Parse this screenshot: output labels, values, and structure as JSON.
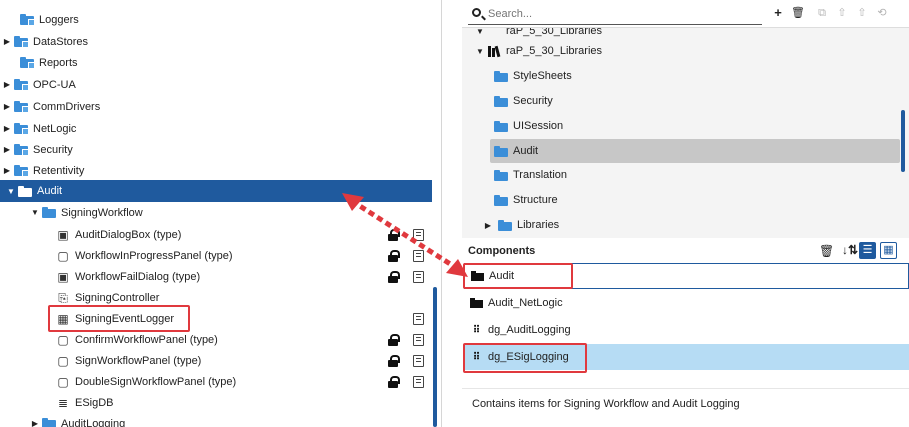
{
  "left_tree": {
    "items": [
      {
        "label": "Loggers",
        "expand": ""
      },
      {
        "label": "DataStores",
        "expand": "▶"
      },
      {
        "label": "Reports",
        "expand": ""
      },
      {
        "label": "OPC-UA",
        "expand": "▶"
      },
      {
        "label": "CommDrivers",
        "expand": "▶"
      },
      {
        "label": "NetLogic",
        "expand": "▶"
      },
      {
        "label": "Security",
        "expand": "▶"
      },
      {
        "label": "Retentivity",
        "expand": "▶"
      },
      {
        "label": "Audit",
        "expand": "▼"
      },
      {
        "label": "SigningWorkflow",
        "expand": "▼"
      },
      {
        "label": "AuditDialogBox (type)",
        "icon": "▣"
      },
      {
        "label": "WorkflowInProgressPanel (type)",
        "icon": "▢"
      },
      {
        "label": "WorkflowFailDialog (type)",
        "icon": "▣"
      },
      {
        "label": "SigningController",
        "icon": "⎘"
      },
      {
        "label": "SigningEventLogger",
        "icon": "▦"
      },
      {
        "label": "ConfirmWorkflowPanel (type)",
        "icon": "▢"
      },
      {
        "label": "SignWorkflowPanel (type)",
        "icon": "▢"
      },
      {
        "label": "DoubleSignWorkflowPanel (type)",
        "icon": "▢"
      },
      {
        "label": "ESigDB",
        "icon": "≣"
      },
      {
        "label": "AuditLogging",
        "expand": "▶"
      }
    ]
  },
  "search": {
    "placeholder": "Search..."
  },
  "toolbar": {
    "add": "+",
    "delete": "🗑",
    "icons": [
      "⧉",
      "⇧",
      "⇧",
      "⟲"
    ]
  },
  "right_tree": {
    "partial_label": "raP_5_30_Libraries",
    "library": "raP_5_30_Libraries",
    "library_expand": "▼",
    "children": [
      "StyleSheets",
      "Security",
      "UISession",
      "Audit",
      "Translation",
      "Structure",
      "Libraries"
    ],
    "libraries_expand": "▶"
  },
  "components": {
    "title": "Components",
    "items": [
      "Audit",
      "Audit_NetLogic",
      "dg_AuditLogging",
      "dg_ESigLogging"
    ],
    "grid_icon": "⠿",
    "description": "Contains items for Signing Workflow and Audit Logging"
  },
  "colors": {
    "accent": "#1f5a9e",
    "highlight": "#e0393e",
    "selection": "#b6dcf4"
  }
}
